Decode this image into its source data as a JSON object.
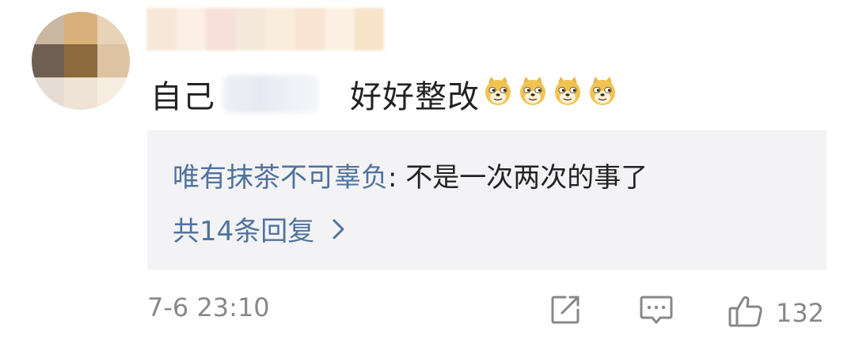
{
  "comment": {
    "text_prefix": "自己",
    "text_suffix": "好好整改",
    "emoji_count": 4,
    "emoji_icon": "doge-emoji-icon"
  },
  "reply": {
    "author": "唯有抹茶不可辜负",
    "separator": ": ",
    "text": "不是一次两次的事了",
    "more_label": "共14条回复"
  },
  "footer": {
    "timestamp": "7-6 23:10",
    "like_count": "132"
  },
  "colors": {
    "link": "#50729d",
    "text": "#222222",
    "muted": "#888888",
    "reply_bg": "#f3f3f5"
  }
}
